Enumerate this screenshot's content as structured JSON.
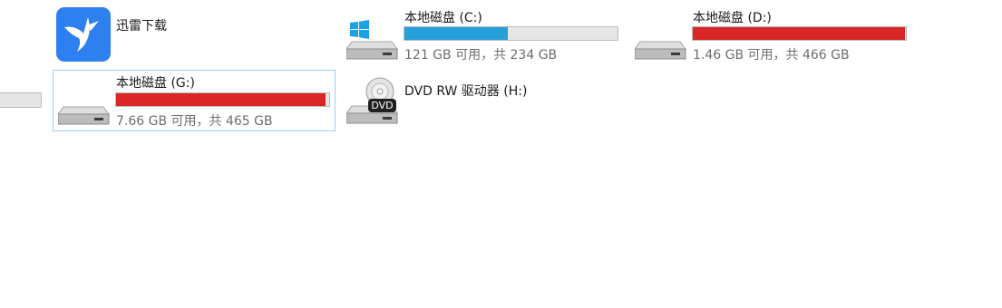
{
  "items": {
    "xunlei": {
      "title": "迅雷下载",
      "icon": "xunlei-bird-icon",
      "color": "#2e7ff0"
    },
    "drive_c": {
      "title": "本地磁盘 (C:)",
      "sub": "121 GB 可用，共 234 GB",
      "used_fraction": 0.483,
      "fill_color": "#26a0da",
      "icon": "windows-drive-icon"
    },
    "drive_d": {
      "title": "本地磁盘 (D:)",
      "sub": "1.46 GB 可用，共 466 GB",
      "used_fraction": 0.997,
      "fill_color": "#da2626",
      "icon": "hard-drive-icon"
    },
    "drive_g": {
      "title": "本地磁盘 (G:)",
      "sub": "7.66 GB 可用，共 465 GB",
      "used_fraction": 0.984,
      "fill_color": "#da2626",
      "icon": "hard-drive-icon"
    },
    "drive_h": {
      "title": "DVD RW 驱动器 (H:)",
      "icon": "dvd-drive-icon",
      "badge": "DVD"
    }
  },
  "colors": {
    "selection_border": "#99d1ff",
    "bar_bg": "#e6e6e6",
    "bar_border": "#bcbcbc"
  }
}
